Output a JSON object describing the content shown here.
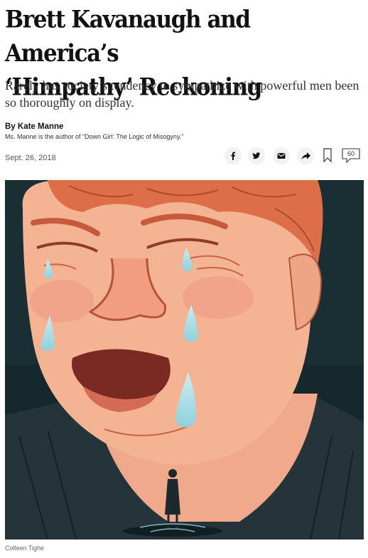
{
  "article": {
    "headline_line1": "Brett Kavanaugh and America’s",
    "headline_line2": "‘Himpathy’ Reckoning",
    "summary": "Rarely has society’s tendency to sympathize with powerful men been so thoroughly on display.",
    "byline": "By Kate Manne",
    "author_note": "Ms. Manne is the author of “Down Girl: The Logic of Misogyny.”",
    "date": "Sept. 26, 2018"
  },
  "share_tools": {
    "icons": [
      "facebook-icon",
      "twitter-icon",
      "email-icon",
      "share-icon",
      "bookmark-icon",
      "comment-icon"
    ],
    "comments_count": "60"
  },
  "image": {
    "credit": "Colleen Tighe"
  },
  "colors": {
    "background_dark": "#15282c",
    "skin": "#f2b08e",
    "hair": "#d96a45",
    "line": "#b5543e",
    "tears": "#9fd6df",
    "suit": "#24343a"
  }
}
